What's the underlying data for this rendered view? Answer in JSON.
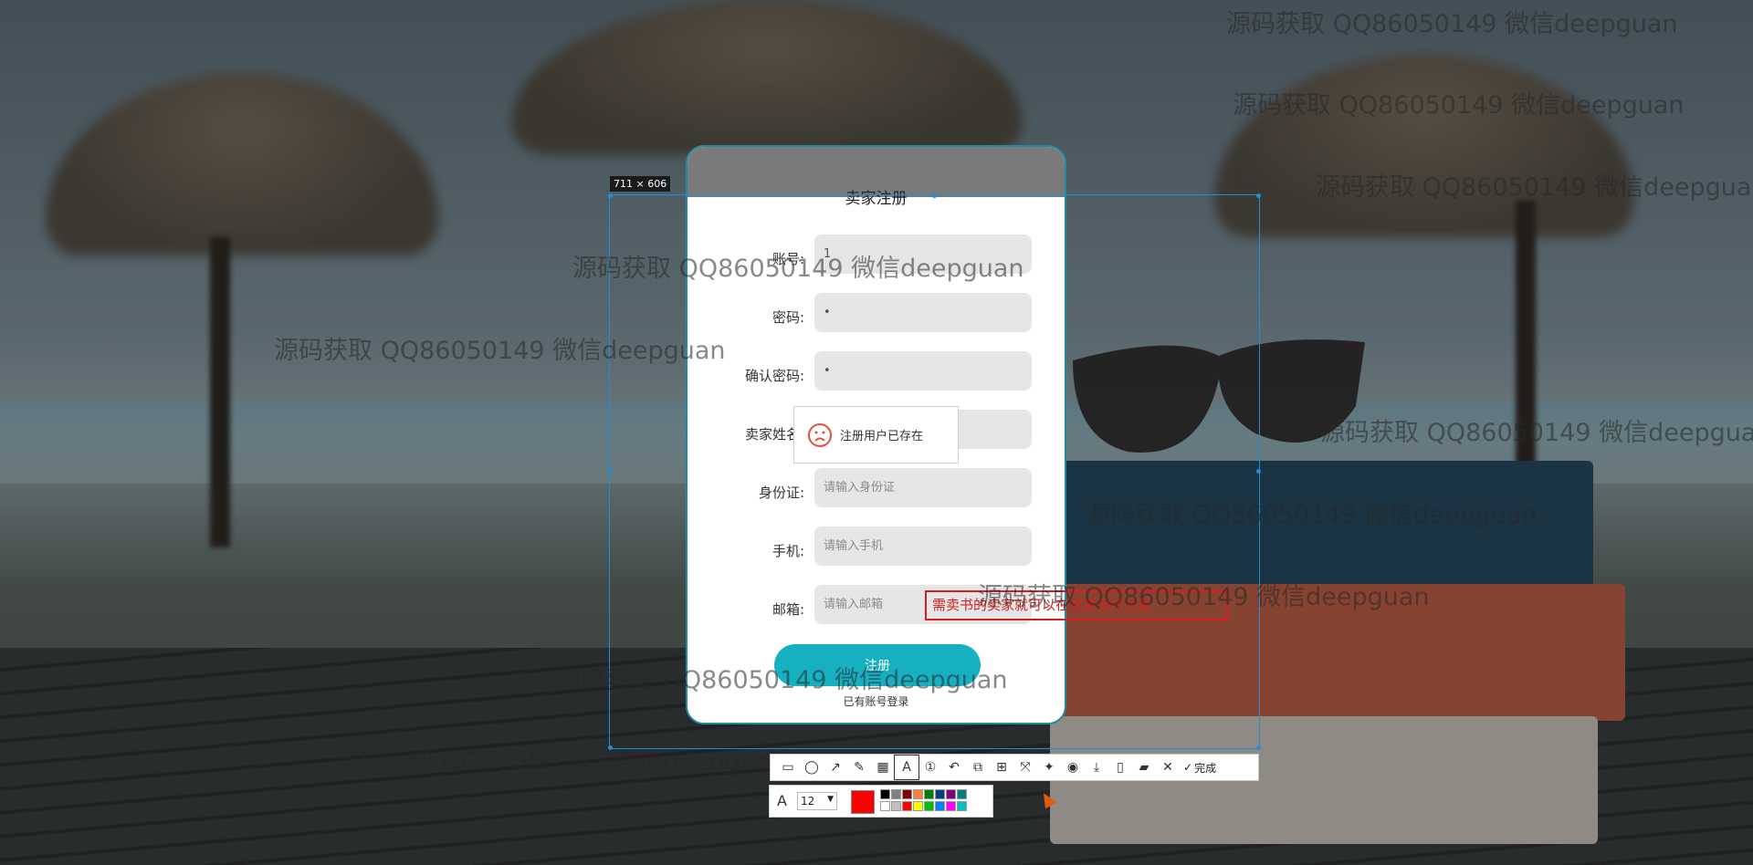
{
  "selection_size": "711 × 606",
  "form": {
    "title": "卖家注册",
    "fields": [
      {
        "label": "账号:",
        "value": "1",
        "placeholder": ""
      },
      {
        "label": "密码:",
        "value": "•",
        "placeholder": ""
      },
      {
        "label": "确认密码:",
        "value": "•",
        "placeholder": ""
      },
      {
        "label": "卖家姓名:",
        "value": "",
        "placeholder": ""
      },
      {
        "label": "身份证:",
        "value": "",
        "placeholder": "请输入身份证"
      },
      {
        "label": "手机:",
        "value": "",
        "placeholder": "请输入手机"
      },
      {
        "label": "邮箱:",
        "value": "",
        "placeholder": "请输入邮箱"
      }
    ],
    "submit_label": "注册",
    "login_link": "已有账号登录"
  },
  "toast": {
    "icon": "sad-face-icon",
    "message": "注册用户已存在"
  },
  "annotation": "需卖书的卖家就可以在这里进行注册",
  "watermark": "源码获取 QQ86050149 微信deepguan",
  "toolbar": {
    "tools": [
      "rectangle-icon",
      "ellipse-icon",
      "arrow-icon",
      "pen-icon",
      "mosaic-icon",
      "text-icon",
      "number-icon",
      "undo-icon",
      "ocr-icon",
      "translate-icon",
      "scroll-capture-icon",
      "pin-icon",
      "record-icon",
      "save-icon",
      "copy-icon",
      "collect-icon",
      "close-icon"
    ],
    "done_label": "完成",
    "font_size": "12",
    "current_color": "#ff0000",
    "palette": [
      "#000000",
      "#808080",
      "#800000",
      "#ff8040",
      "#008000",
      "#004080",
      "#800080",
      "#008080",
      "#ffffff",
      "#c0c0c0",
      "#ff0000",
      "#ffff00",
      "#00c000",
      "#0080ff",
      "#ff00ff",
      "#00c0c0"
    ]
  }
}
